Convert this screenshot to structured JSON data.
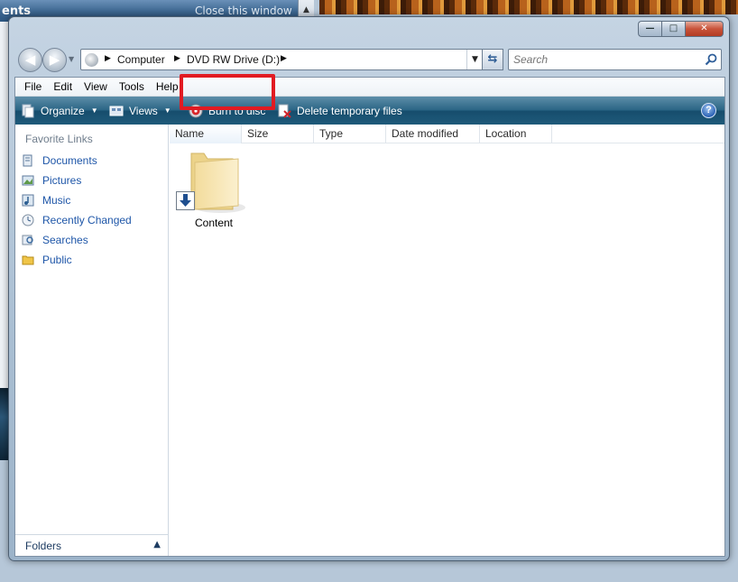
{
  "background": {
    "window_title_fragment": "ents",
    "window_close_hint": "Close this window"
  },
  "window": {
    "controls": {
      "minimize": "—",
      "maximize": "□",
      "close": "✕"
    }
  },
  "address": {
    "breadcrumbs": [
      "Computer",
      "DVD RW Drive (D:)"
    ],
    "icon": "computer-icon"
  },
  "search": {
    "placeholder": "Search",
    "icon": "search-icon"
  },
  "menu": {
    "items": [
      "File",
      "Edit",
      "View",
      "Tools",
      "Help"
    ]
  },
  "toolbar": {
    "organize": "Organize",
    "views": "Views",
    "burn": "Burn to disc",
    "delete_temp": "Delete temporary files",
    "help": "?"
  },
  "annotation": {
    "highlight_color": "#e11b22"
  },
  "navpane": {
    "title": "Favorite Links",
    "links": [
      {
        "label": "Documents",
        "icon": "documents-icon"
      },
      {
        "label": "Pictures",
        "icon": "pictures-icon"
      },
      {
        "label": "Music",
        "icon": "music-icon"
      },
      {
        "label": "Recently Changed",
        "icon": "recently-changed-icon"
      },
      {
        "label": "Searches",
        "icon": "searches-icon"
      },
      {
        "label": "Public",
        "icon": "public-folder-icon"
      }
    ],
    "folders_label": "Folders"
  },
  "filelist": {
    "columns": [
      "Name",
      "Size",
      "Type",
      "Date modified",
      "Location"
    ],
    "items": [
      {
        "name": "Content",
        "icon": "folder-icon",
        "overlay": "pending-burn-icon"
      }
    ]
  }
}
